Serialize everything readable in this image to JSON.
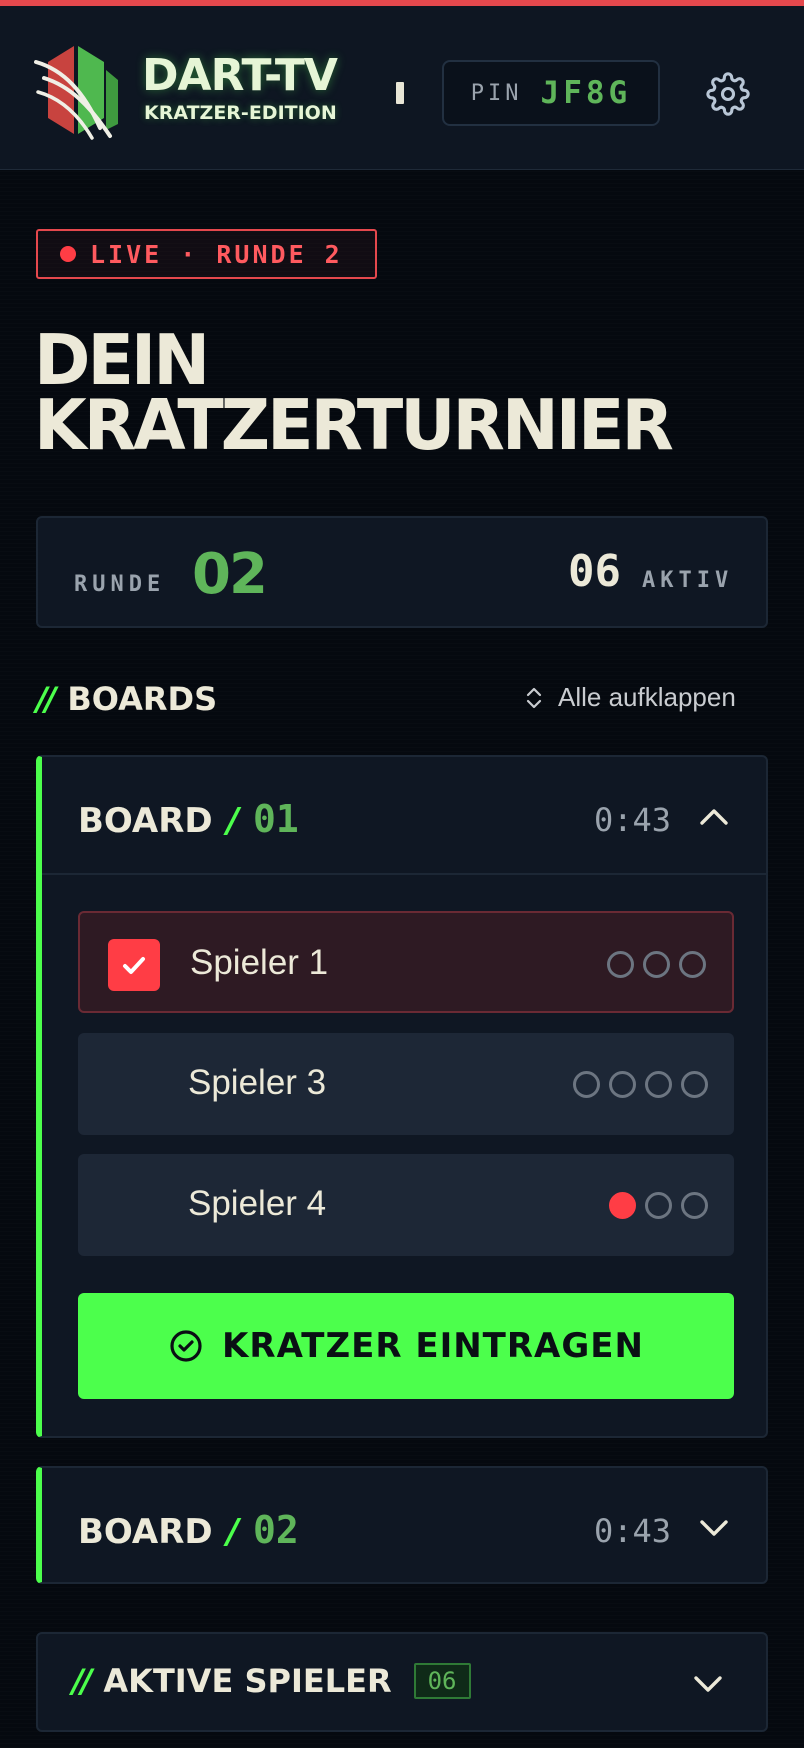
{
  "header": {
    "brand_title": "DART-TV",
    "brand_subtitle": "KRATZER-EDITION",
    "pin_label": "PIN",
    "pin_code": "JF8G",
    "settings_icon": "gear-icon"
  },
  "status": {
    "live_label": "LIVE · RUNDE 2"
  },
  "page": {
    "title_line1": "DEIN",
    "title_line2": "KRATZERTURNIER"
  },
  "round_card": {
    "round_label": "RUNDE",
    "round_value": "02",
    "active_value": "06",
    "active_label": "AKTIV"
  },
  "boards_section": {
    "slashes": "//",
    "title": "BOARDS",
    "expand_all_label": "Alle aufklappen"
  },
  "boards": [
    {
      "word": "BOARD",
      "slash": "/",
      "number": "01",
      "time": "0:43",
      "expanded": true,
      "players": [
        {
          "name": "Spieler 1",
          "selected": true,
          "scratches": [
            false,
            false,
            false
          ]
        },
        {
          "name": "Spieler 3",
          "selected": false,
          "scratches": [
            false,
            false,
            false,
            false
          ]
        },
        {
          "name": "Spieler 4",
          "selected": false,
          "scratches": [
            true,
            false,
            false
          ]
        }
      ],
      "submit_label": "KRATZER EINTRAGEN"
    },
    {
      "word": "BOARD",
      "slash": "/",
      "number": "02",
      "time": "0:43",
      "expanded": false
    }
  ],
  "active_players": {
    "slashes": "//",
    "title": "AKTIVE SPIELER",
    "count": "06"
  },
  "colors": {
    "accent_green": "#4cff4c",
    "accent_red": "#ff3d45",
    "background": "#05090f",
    "card": "#0f1723"
  }
}
